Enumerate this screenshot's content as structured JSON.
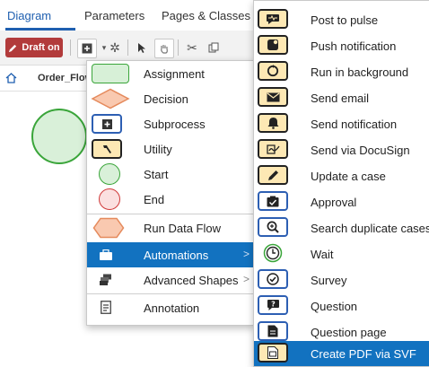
{
  "tabs": [
    "Diagram",
    "Parameters",
    "Pages & Classes"
  ],
  "toolbar": {
    "draft_label": "Draft on"
  },
  "breadcrumb": {
    "label": "Order_Flow"
  },
  "shape_menu": {
    "items": [
      {
        "label": "Assignment",
        "icon": "assignment-shape-icon"
      },
      {
        "label": "Decision",
        "icon": "decision-shape-icon"
      },
      {
        "label": "Subprocess",
        "icon": "subprocess-shape-icon"
      },
      {
        "label": "Utility",
        "icon": "utility-shape-icon"
      },
      {
        "label": "Start",
        "icon": "start-shape-icon"
      },
      {
        "label": "End",
        "icon": "end-shape-icon"
      },
      {
        "label": "Run Data Flow",
        "icon": "run-data-flow-shape-icon"
      },
      {
        "label": "Automations",
        "icon": "automations-icon",
        "selected": true,
        "has_submenu": true
      },
      {
        "label": "Advanced Shapes",
        "icon": "advanced-shapes-icon",
        "has_submenu": true
      },
      {
        "label": "Annotation",
        "icon": "annotation-icon"
      }
    ]
  },
  "automations_menu": {
    "items": [
      {
        "label": "Post to pulse",
        "icon": "pulse-icon",
        "style": "util"
      },
      {
        "label": "Push notification",
        "icon": "push-notification-icon",
        "style": "util"
      },
      {
        "label": "Run in background",
        "icon": "run-background-icon",
        "style": "util"
      },
      {
        "label": "Send email",
        "icon": "email-icon",
        "style": "util"
      },
      {
        "label": "Send notification",
        "icon": "bell-icon",
        "style": "util"
      },
      {
        "label": "Send via DocuSign",
        "icon": "docusign-icon",
        "style": "util"
      },
      {
        "label": "Update a case",
        "icon": "pencil-icon",
        "style": "util"
      },
      {
        "label": "Approval",
        "icon": "approval-icon",
        "style": "sub"
      },
      {
        "label": "Search duplicate cases",
        "icon": "search-duplicate-icon",
        "style": "sub"
      },
      {
        "label": "Wait",
        "icon": "clock-icon",
        "style": "wait"
      },
      {
        "label": "Survey",
        "icon": "survey-icon",
        "style": "sub"
      },
      {
        "label": "Question",
        "icon": "question-icon",
        "style": "sub"
      },
      {
        "label": "Question page",
        "icon": "question-page-icon",
        "style": "sub"
      },
      {
        "label": "Create PDF via SVF",
        "icon": "pdf-icon",
        "style": "util",
        "selected": true
      }
    ]
  },
  "colors": {
    "selected": "#1272c0",
    "draft": "#b23b3b",
    "tab_active": "#1f5fb0",
    "utility_fill": "#fde8b4",
    "subprocess_border": "#2d5fb3",
    "start_border": "#3aa53a",
    "end_border": "#d03a3a",
    "decision_fill": "#f9c9b0"
  }
}
